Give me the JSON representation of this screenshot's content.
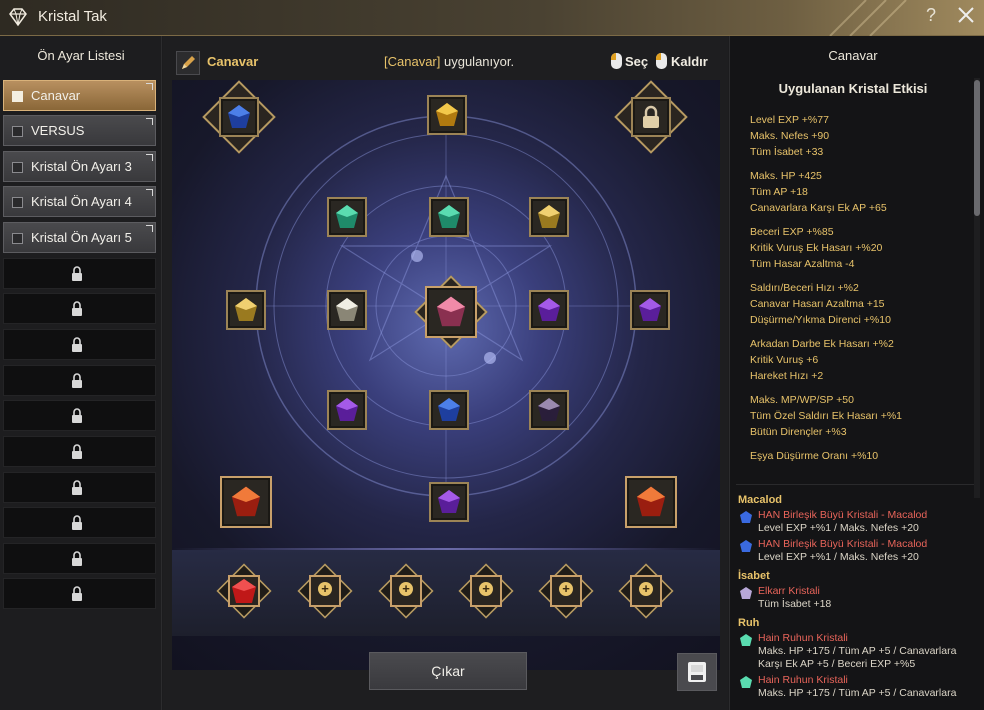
{
  "window": {
    "title": "Kristal Tak",
    "help": "?"
  },
  "left": {
    "header": "Ön Ayar Listesi",
    "presets": [
      {
        "label": "Canavar",
        "active": true
      },
      {
        "label": "VERSUS",
        "active": false
      },
      {
        "label": "Kristal Ön Ayarı 3",
        "active": false
      },
      {
        "label": "Kristal Ön Ayarı 4",
        "active": false
      },
      {
        "label": "Kristal Ön Ayarı 5",
        "active": false
      }
    ],
    "locked_count": 10
  },
  "center": {
    "preset_name": "Canavar",
    "status_hl": "[Canavar]",
    "status_rest": " uygulanıyor.",
    "select_label": "Seç",
    "remove_label": "Kaldır",
    "remove_button": "Çıkar"
  },
  "right": {
    "header": "Canavar",
    "subheader": "Uygulanan Kristal Etkisi",
    "effect_groups": [
      [
        "Level EXP +%77",
        "Maks. Nefes +90",
        "Tüm İsabet +33"
      ],
      [
        "Maks. HP +425",
        "Tüm AP +18",
        "Canavarlara Karşı Ek AP +65"
      ],
      [
        "Beceri EXP +%85",
        "Kritik Vuruş Ek Hasarı +%20",
        "Tüm Hasar Azaltma -4"
      ],
      [
        "Saldırı/Beceri Hızı +%2",
        "Canavar Hasarı Azaltma +15",
        "Düşürme/Yıkma Direnci +%10"
      ],
      [
        "Arkadan Darbe Ek Hasarı +%2",
        "Kritik Vuruş +6",
        "Hareket Hızı +2"
      ],
      [
        "Maks. MP/WP/SP +50",
        "Tüm Özel Saldırı Ek Hasarı +%1",
        "Bütün Dirençler +%3"
      ],
      [
        "Eşya Düşürme Oranı +%10"
      ]
    ],
    "sources": [
      {
        "category": "Macalod",
        "items": [
          {
            "name": "HAN Birleşik Büyü Kristali - Macalod",
            "desc": "Level EXP +%1 / Maks. Nefes +20",
            "icon": "blue-crystal-icon"
          },
          {
            "name": "HAN Birleşik Büyü Kristali - Macalod",
            "desc": "Level EXP +%1 / Maks. Nefes +20",
            "icon": "blue-crystal-icon"
          }
        ]
      },
      {
        "category": "İsabet",
        "items": [
          {
            "name": "Elkarr Kristali",
            "desc": "Tüm İsabet +18",
            "icon": "dark-crystal-icon"
          }
        ]
      },
      {
        "category": "Ruh",
        "items": [
          {
            "name": "Hain Ruhun Kristali",
            "desc": "Maks. HP +175 / Tüm AP +5 / Canavarlara Karşı Ek AP +5 / Beceri EXP +%5",
            "icon": "green-crystal-icon"
          },
          {
            "name": "Hain Ruhun Kristali",
            "desc": "Maks. HP +175 / Tüm AP +5 / Canavarlara",
            "icon": "green-crystal-icon"
          }
        ]
      }
    ]
  }
}
